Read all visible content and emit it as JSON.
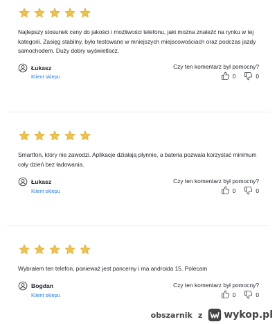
{
  "reviews": [
    {
      "rating": 5,
      "max_rating": 5,
      "text": "Najlepszy stosunek ceny do jakości i możliwości telefonu, jaki można znaleźć na rynku w tej kategorii. Zasięg stabilny, było testowane w mniejszych miejscowościach oraz podczas jazdy samochodem. Duży dobry wyświetlacz.",
      "author": "Łukasz",
      "role": "Klient sklepu",
      "helpful_question": "Czy ten komentarz był pomocny?",
      "likes": "0",
      "dislikes": "0"
    },
    {
      "rating": 5,
      "max_rating": 5,
      "text": "Smartfon, który nie zawodzi. Aplikacje działają płynnie, a bateria pozwala korzystać minimum cały dzień bez ładowania.",
      "author": "Łukasz",
      "role": "Klient sklepu",
      "helpful_question": "Czy ten komentarz był pomocny?",
      "likes": "0",
      "dislikes": "0"
    },
    {
      "rating": 5,
      "max_rating": 5,
      "text": "Wybrałem ten telefon, ponieważ jest pancerny i ma androida 15. Polecam",
      "author": "Bogdan",
      "role": "Klient sklepu",
      "helpful_question": "Czy ten komentarz był pomocny?",
      "likes": "0",
      "dislikes": "0"
    }
  ],
  "watermark": {
    "user": "obszarnik",
    "separator": "z",
    "brand": "wykop.pl"
  },
  "colors": {
    "star": "#f0c14b",
    "link": "#2c7be0",
    "divider": "#e9eaec"
  },
  "icons": {
    "star": "star-icon",
    "user": "user-circle-icon",
    "like": "thumbs-up-icon",
    "dislike": "thumbs-down-icon",
    "logo": "wykop-logo-icon"
  }
}
